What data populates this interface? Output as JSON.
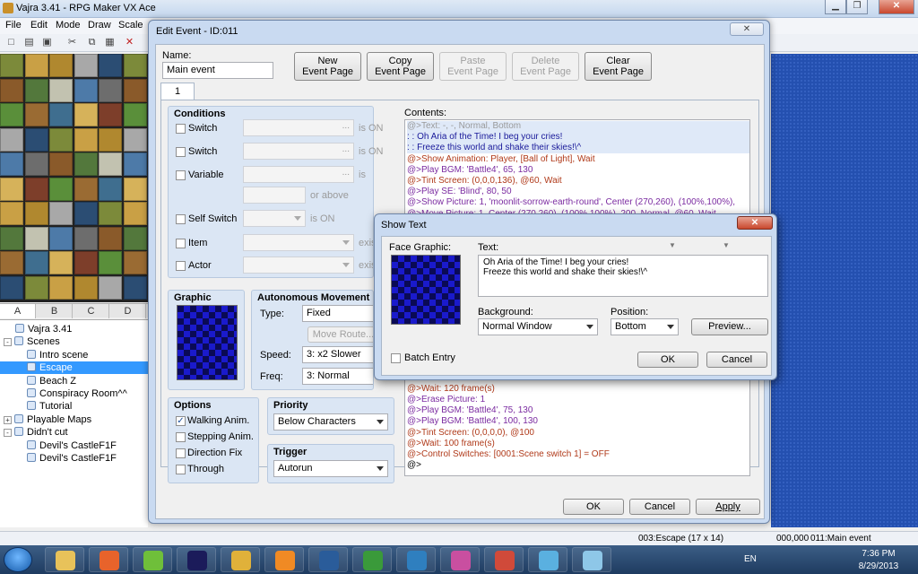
{
  "app": {
    "title": "Vajra 3.41 - RPG Maker VX Ace",
    "menu": [
      "File",
      "Edit",
      "Mode",
      "Draw",
      "Scale"
    ],
    "tile_tabs": [
      "A",
      "B",
      "C",
      "D"
    ],
    "map_tree": [
      {
        "label": "Vajra 3.41",
        "level": 0,
        "expander": ""
      },
      {
        "label": "Scenes",
        "level": 0,
        "expander": "-"
      },
      {
        "label": "Intro scene",
        "level": 1,
        "expander": ""
      },
      {
        "label": "Escape",
        "level": 1,
        "expander": "",
        "selected": true
      },
      {
        "label": "Beach Z",
        "level": 1,
        "expander": ""
      },
      {
        "label": "Conspiracy Room^^",
        "level": 1,
        "expander": ""
      },
      {
        "label": "Tutorial",
        "level": 1,
        "expander": ""
      },
      {
        "label": "Playable Maps",
        "level": 0,
        "expander": "+"
      },
      {
        "label": "Didn't cut",
        "level": 0,
        "expander": "-"
      },
      {
        "label": "Devil's CastleF1F",
        "level": 1,
        "expander": ""
      },
      {
        "label": "Devil's CastleF1F",
        "level": 1,
        "expander": ""
      }
    ],
    "status": {
      "map": "003:Escape (17 x 14)",
      "coords": "000,000",
      "event": "011:Main event"
    }
  },
  "taskbar": {
    "language": "EN",
    "time": "7:36 PM",
    "date": "8/29/2013",
    "apps": [
      {
        "name": "explorer-icon",
        "color": "#e8c25a"
      },
      {
        "name": "firefox-icon",
        "color": "#e8632b"
      },
      {
        "name": "utorrent-icon",
        "color": "#6fbf3a"
      },
      {
        "name": "media-icon",
        "color": "#1b1b5a"
      },
      {
        "name": "chrome-icon",
        "color": "#e0b13a"
      },
      {
        "name": "player-icon",
        "color": "#f08a24"
      },
      {
        "name": "photoshop-icon",
        "color": "#2a5c9a"
      },
      {
        "name": "q-icon",
        "color": "#3a9a3a"
      },
      {
        "name": "download-icon",
        "color": "#2f7fbf"
      },
      {
        "name": "game-icon",
        "color": "#c94fa0"
      },
      {
        "name": "rpg-maker-icon",
        "color": "#d04a3a"
      },
      {
        "name": "paint-icon",
        "color": "#5ab0e0"
      },
      {
        "name": "notepad-icon",
        "color": "#8ec7e8"
      }
    ]
  },
  "edit_event": {
    "title": "Edit Event - ID:011",
    "close": "✕",
    "name_label": "Name:",
    "name_value": "Main event",
    "buttons": {
      "new_page": [
        "New",
        "Event Page"
      ],
      "copy_page": [
        "Copy",
        "Event Page"
      ],
      "paste_page": [
        "Paste",
        "Event Page"
      ],
      "delete_page": [
        "Delete",
        "Event Page"
      ],
      "clear_page": [
        "Clear",
        "Event Page"
      ]
    },
    "page_tab": "1",
    "conditions": {
      "title": "Conditions",
      "switch1": "Switch",
      "switch2": "Switch",
      "variable": "Variable",
      "self_switch": "Self Switch",
      "item": "Item",
      "actor": "Actor",
      "is_on_1": "is ON",
      "is_on_2": "is ON",
      "is": "is",
      "or_above": "or above",
      "is_on_3": "is ON",
      "exist_1": "exist",
      "exist_2": "exist",
      "ellipsis": "..."
    },
    "graphic": {
      "title": "Graphic"
    },
    "autonomous": {
      "title": "Autonomous Movement",
      "type_label": "Type:",
      "type_value": "Fixed",
      "move_route": "Move Route...",
      "speed_label": "Speed:",
      "speed_value": "3: x2 Slower",
      "freq_label": "Freq:",
      "freq_value": "3: Normal"
    },
    "options": {
      "title": "Options",
      "walking": "Walking Anim.",
      "stepping": "Stepping Anim.",
      "direction_fix": "Direction Fix",
      "through": "Through",
      "checked": "✓"
    },
    "priority": {
      "title": "Priority",
      "value": "Below Characters"
    },
    "trigger": {
      "title": "Trigger",
      "value": "Autorun"
    },
    "contents_label": "Contents:",
    "contents": [
      {
        "text": "@>Text: -, -, Normal, Bottom",
        "color": "#9a9a9a"
      },
      {
        "text": " :       : Oh Aria of the Time! I beg your cries!",
        "color": "#1a1a9a"
      },
      {
        "text": " :       : Freeze this world and shake their skies!\\^",
        "color": "#1a1a9a"
      },
      {
        "text": "@>Show Animation: Player, [Ball of Light], Wait",
        "color": "#b03a1a"
      },
      {
        "text": "@>Play BGM: 'Battle4', 65, 130",
        "color": "#7a2aa0"
      },
      {
        "text": "@>Tint Screen: (0,0,0,136), @60, Wait",
        "color": "#b03a1a"
      },
      {
        "text": "@>Play SE: 'Blind', 80, 50",
        "color": "#7a2aa0"
      },
      {
        "text": "@>Show Picture: 1, 'moonlit-sorrow-earth-round', Center (270,260), (100%,100%),",
        "color": "#7a2aa0"
      },
      {
        "text": "@>Move Picture: 1, Center (270,260), (100%,100%), 200, Normal, @60, Wait",
        "color": "#7a2aa0"
      },
      {
        "text": "",
        "color": "#000000"
      },
      {
        "text": "",
        "color": "#000000"
      },
      {
        "text": "",
        "color": "#000000"
      },
      {
        "text": "",
        "color": "#000000"
      },
      {
        "text": "",
        "color": "#000000"
      },
      {
        "text": "",
        "color": "#000000"
      },
      {
        "text": "",
        "color": "#000000"
      },
      {
        "text": "",
        "color": "#000000"
      },
      {
        "text": "",
        "color": "#000000"
      },
      {
        "text": "",
        "color": "#000000"
      },
      {
        "text": "",
        "color": "#000000"
      },
      {
        "text": "",
        "color": "#000000"
      },
      {
        "text": "",
        "color": "#000000"
      },
      {
        "text": "",
        "color": "#000000"
      },
      {
        "text": "",
        "color": "#000000"
      },
      {
        "text": "@>Wait: 120 frame(s)",
        "color": "#b03a1a"
      },
      {
        "text": "@>Erase Picture: 1",
        "color": "#7a2aa0"
      },
      {
        "text": "@>Play BGM: 'Battle4', 75, 130",
        "color": "#7a2aa0"
      },
      {
        "text": "@>Play BGM: 'Battle4', 100, 130",
        "color": "#7a2aa0"
      },
      {
        "text": "@>Tint Screen: (0,0,0,0), @100",
        "color": "#b03a1a"
      },
      {
        "text": "@>Wait: 100 frame(s)",
        "color": "#b03a1a"
      },
      {
        "text": "@>Control Switches: [0001:Scene switch 1] = OFF",
        "color": "#b03a1a"
      },
      {
        "text": "@>",
        "color": "#000000"
      }
    ],
    "footer": {
      "ok": "OK",
      "cancel": "Cancel",
      "apply": "Apply"
    }
  },
  "show_text": {
    "title": "Show Text",
    "close": "✕",
    "face_label": "Face Graphic:",
    "text_label": "Text:",
    "line1": "Oh Aria of the Time! I beg your cries!",
    "line2": "Freeze this world and shake their skies!\\^",
    "background_label": "Background:",
    "background_value": "Normal Window",
    "position_label": "Position:",
    "position_value": "Bottom",
    "preview": "Preview...",
    "batch_entry": "Batch Entry",
    "ok": "OK",
    "cancel": "Cancel"
  }
}
